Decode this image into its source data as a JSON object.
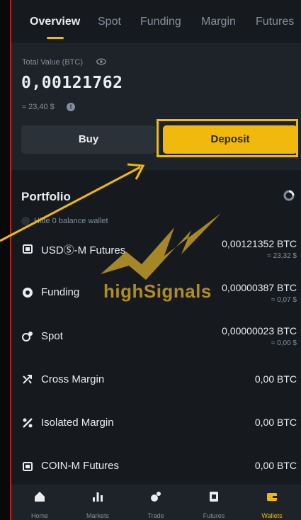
{
  "tabs": [
    "Overview",
    "Spot",
    "Funding",
    "Margin",
    "Futures"
  ],
  "balance": {
    "label": "Total Value (BTC)",
    "value": "0,00121762",
    "usd": "≈ 23,40 $"
  },
  "actions": {
    "buy": "Buy",
    "deposit": "Deposit"
  },
  "portfolio": {
    "title": "Portfolio",
    "hide_label": "Hide 0 balance wallet",
    "rows": [
      {
        "icon": "futures-icon",
        "label": "USDⓈ-M Futures",
        "amount": "0,00121352 BTC",
        "usd": "≈ 23,32 $"
      },
      {
        "icon": "funding-icon",
        "label": "Funding",
        "amount": "0,00000387 BTC",
        "usd": "≈ 0,07 $"
      },
      {
        "icon": "spot-icon",
        "label": "Spot",
        "amount": "0,00000023 BTC",
        "usd": "≈ 0,00 $"
      },
      {
        "icon": "cross-margin-icon",
        "label": "Cross Margin",
        "amount": "0,00 BTC",
        "usd": ""
      },
      {
        "icon": "isolated-margin-icon",
        "label": "Isolated Margin",
        "amount": "0,00 BTC",
        "usd": ""
      },
      {
        "icon": "coin-futures-icon",
        "label": "COIN-M Futures",
        "amount": "0,00 BTC",
        "usd": ""
      }
    ]
  },
  "watermark": "highSignals",
  "nav": [
    {
      "label": "Home",
      "icon": "home-icon"
    },
    {
      "label": "Markets",
      "icon": "markets-icon"
    },
    {
      "label": "Trade",
      "icon": "trade-icon"
    },
    {
      "label": "Futures",
      "icon": "futures-nav-icon"
    },
    {
      "label": "Wallets",
      "icon": "wallet-icon"
    }
  ],
  "colors": {
    "accent": "#f0b90b",
    "background": "#161a1e",
    "card": "#1e2329",
    "muted": "#848e9c",
    "frame": "#b3261e"
  }
}
